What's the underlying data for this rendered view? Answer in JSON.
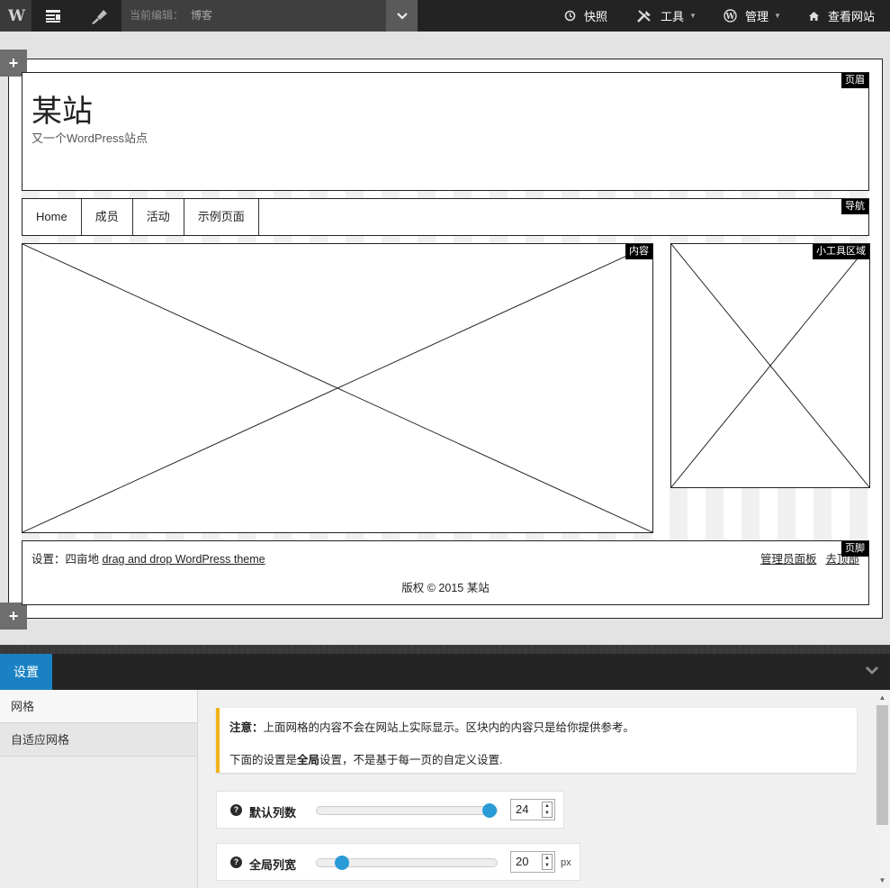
{
  "topbar": {
    "editing_label": "当前编辑：",
    "editing_value": "博客",
    "menu": {
      "snapshot": "快照",
      "tools": "工具",
      "manage": "管理",
      "view_site": "查看网站"
    },
    "icons": [
      "headway-logo-icon",
      "grid-layout-icon",
      "design-brush-icon",
      "chevron-down-icon",
      "history-icon",
      "tools-icon",
      "wordpress-icon",
      "home-icon"
    ]
  },
  "canvas": {
    "add_row": "+",
    "header": {
      "tag": "页眉",
      "site_title": "某站",
      "site_desc": "又一个WordPress站点"
    },
    "nav": {
      "tag": "导航",
      "items": [
        "Home",
        "成员",
        "活动",
        "示例页面"
      ]
    },
    "content": {
      "tag": "内容"
    },
    "widget": {
      "tag": "小工具区域"
    },
    "footer": {
      "tag": "页脚",
      "settings_prefix": "设置：四亩地 ",
      "theme_link": "drag and drop WordPress theme",
      "admin_link": "管理员面板",
      "top_link": "去顶部",
      "copyright": "版权 © 2015 某站"
    }
  },
  "panel": {
    "tab": "设置",
    "side_nav": [
      "网格",
      "自适应网格"
    ],
    "notice": {
      "p1_bold": "注意：",
      "p1_rest": "上面网格的内容不会在网站上实际显示。区块内的内容只是给你提供参考。",
      "p2_pre": "下面的设置是",
      "p2_bold": "全局",
      "p2_post": "设置，不是基于每一页的自定义设置."
    },
    "settings": [
      {
        "label": "默认列数",
        "value": "24",
        "unit": "",
        "fill": 1.0
      },
      {
        "label": "全局列宽",
        "value": "20",
        "unit": "px",
        "fill": 0.14
      }
    ]
  },
  "colors": {
    "accent": "#1a82c4",
    "slider": "#2a9bd6",
    "notice_border": "#f2b31a",
    "topbar": "#232323"
  }
}
